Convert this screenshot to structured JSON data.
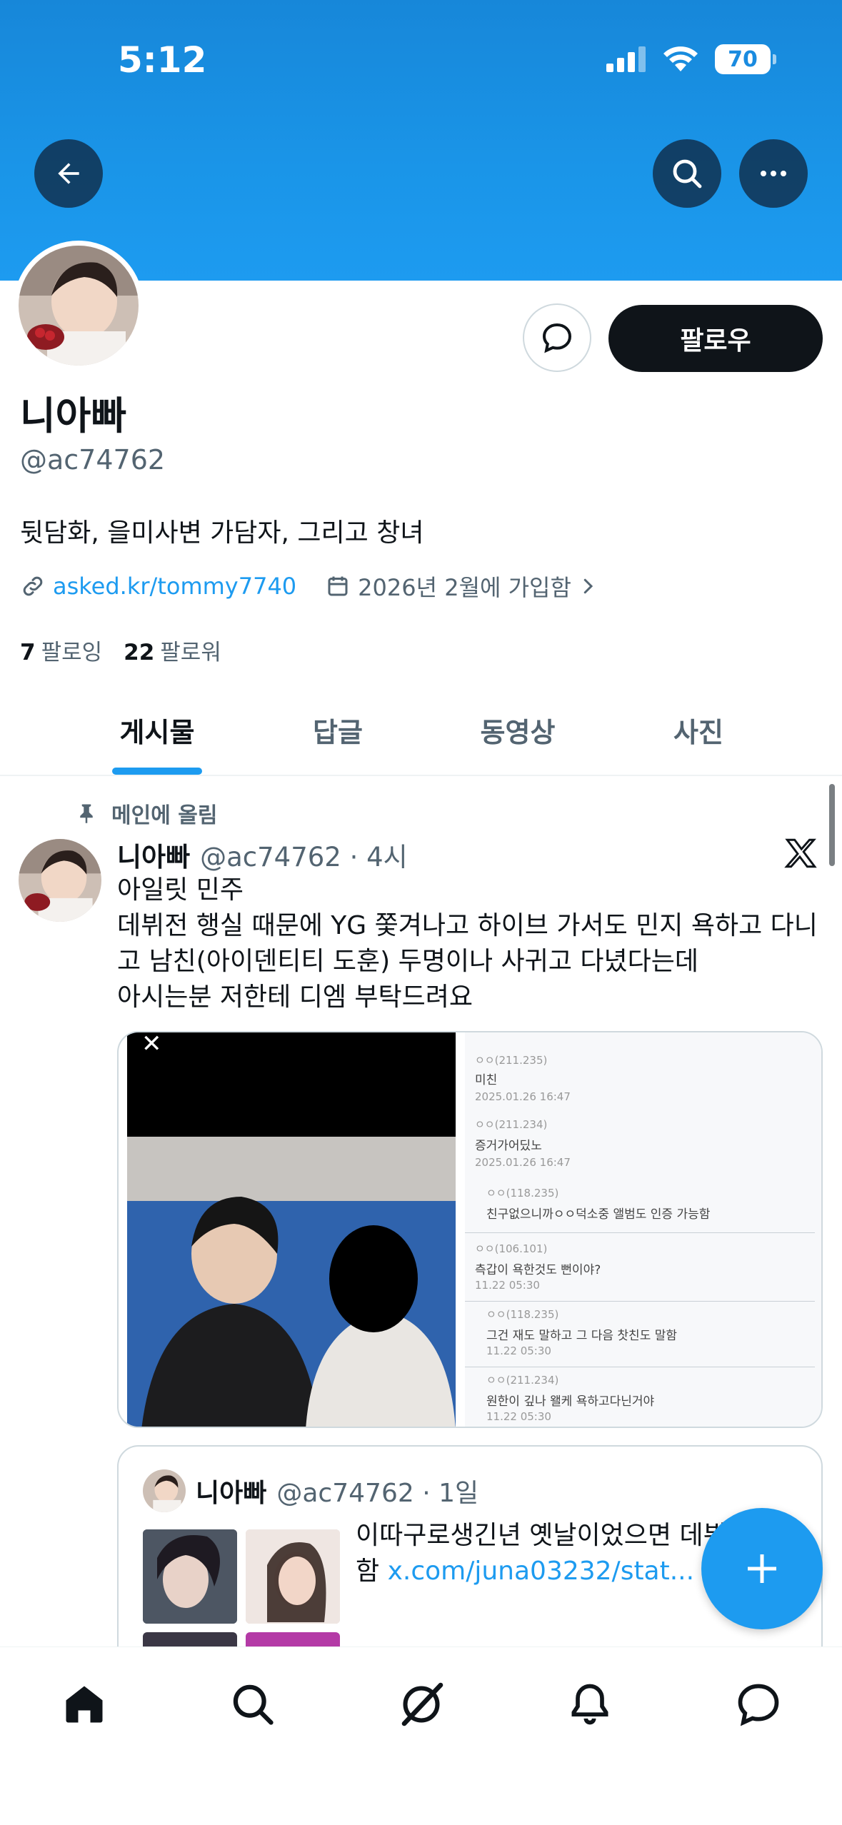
{
  "status_bar": {
    "time": "5:12",
    "battery": "70"
  },
  "profile": {
    "display_name": "니아빠",
    "handle": "@ac74762",
    "bio": "뒷담화, 을미사변 가담자, 그리고 창녀",
    "link": "asked.kr/tommy7740",
    "joined": "2026년 2월에 가입함",
    "following_count": "7",
    "following_label": "팔로잉",
    "followers_count": "22",
    "followers_label": "팔로워",
    "follow_button": "팔로우"
  },
  "tabs": [
    {
      "label": "게시물",
      "active": true
    },
    {
      "label": "답글",
      "active": false
    },
    {
      "label": "동영상",
      "active": false
    },
    {
      "label": "사진",
      "active": false
    }
  ],
  "pinned_post": {
    "pinned_label": "메인에 올림",
    "author_name": "니아빠",
    "author_meta": "@ac74762 · 4시",
    "text_lines": [
      "아일릿 민주",
      "데뷔전 행실 때문에 YG 쫓겨나고 하이브 가서도 민지 욕하고 다니",
      "고 남친(아이덴티티 도훈) 두명이나 사귀고 다녔다는데",
      "아시는분 저한테 디엠 부탁드려요"
    ],
    "media_comments": [
      {
        "id": "ㅇㅇ(211.235)",
        "text": "미친",
        "date": "2025.01.26 16:47"
      },
      {
        "id": "ㅇㅇ(211.234)",
        "text": "증거가어딨노",
        "date": "2025.01.26 16:47"
      },
      {
        "id": "ㅇㅇ(118.235)",
        "text": "친구없으니까ㅇㅇ덕소중 앨범도 인증 가능함",
        "date": ""
      },
      {
        "id": "ㅇㅇ(106.101)",
        "text": "측갑이 욕한것도 뻔이야?",
        "date": "11.22 05:30"
      },
      {
        "id": "ㅇㅇ(118.235)",
        "text": "그건 재도 말하고 그 다음 찻친도 말함",
        "date": "11.22 05:30"
      },
      {
        "id": "ㅇㅇ(211.234)",
        "text": "원한이 깊나 왤케 욕하고다닌거야",
        "date": "11.22 05:30"
      }
    ]
  },
  "quoted_post": {
    "author_name": "니아빠",
    "author_meta": "@ac74762 · 1일",
    "text_line1": "이따구로생긴년 옛날이었으면 데뷔",
    "text_line2_prefix": "함 ",
    "text_link": "x.com/juna03232/stat..."
  },
  "icons": {
    "back": "arrow-left-icon",
    "search": "search-icon",
    "more": "more-icon",
    "message": "message-icon",
    "compose": "plus-icon"
  },
  "colors": {
    "brand": "#1d9bf0",
    "banner": "#1a95e8",
    "text": "#0f1419",
    "muted": "#536471"
  }
}
